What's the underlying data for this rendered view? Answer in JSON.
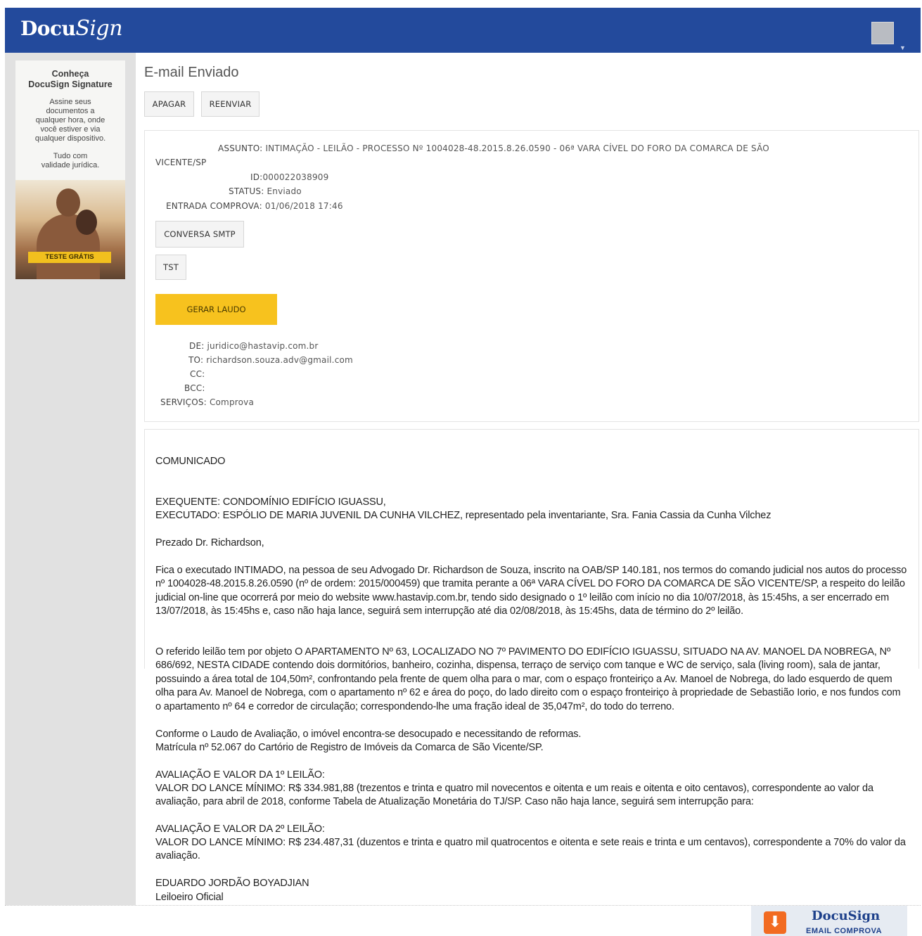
{
  "header": {
    "logo_docu": "Docu",
    "logo_sign": "Sign",
    "avatar_caret": "▼"
  },
  "promo": {
    "title_line1": "Conheça",
    "title_line2": "DocuSign Signature",
    "text_lines": [
      "Assine seus",
      "documentos a",
      "qualquer hora, onde",
      "você estiver e via",
      "qualquer dispositivo."
    ],
    "text2_lines": [
      "Tudo com",
      "validade jurídica."
    ],
    "cta": "TESTE GRÁTIS"
  },
  "page": {
    "title": "E-mail Enviado",
    "delete_label": "APAGAR",
    "resend_label": "REENVIAR"
  },
  "details": {
    "subject_label": "ASSUNTO:",
    "subject_value_line1": "INTIMAÇÃO - LEILÃO - PROCESSO Nº 1004028-48.2015.8.26.0590 - 06ª VARA CÍVEL DO FORO DA COMARCA DE SÃO",
    "subject_value_line2": "VICENTE/SP",
    "id_label": "ID:",
    "id_value": "000022038909",
    "status_label": "STATUS:",
    "status_value": "Enviado",
    "entry_label": "ENTRADA COMPROVA:",
    "entry_value": "01/06/2018 17:46",
    "smtp_button": "CONVERSA SMTP",
    "tst_button": "TST",
    "report_button": "GERAR LAUDO",
    "from_label": "DE:",
    "from_value": "juridico@hastavip.com.br",
    "to_label": "TO:",
    "to_value": "richardson.souza.adv@gmail.com",
    "cc_label": "CC:",
    "cc_value": "",
    "bcc_label": "BCC:",
    "bcc_value": "",
    "services_label": "SERVIÇOS:",
    "services_value": "Comprova"
  },
  "message": {
    "heading": "COMUNICADO",
    "exequente": "EXEQUENTE: CONDOMÍNIO EDIFÍCIO IGUASSU,",
    "executado": "EXECUTADO: ESPÓLIO DE MARIA JUVENIL DA CUNHA VILCHEZ, representado pela inventariante, Sra. Fania Cassia da Cunha Vilchez",
    "greeting": "Prezado Dr. Richardson,",
    "para1": "Fica o executado INTIMADO, na pessoa de seu Advogado Dr. Richardson de Souza, inscrito na OAB/SP 140.181, nos termos do comando judicial nos autos do processo nº 1004028-48.2015.8.26.0590 (nº de ordem: 2015/000459) que tramita perante a 06ª VARA CÍVEL DO FORO DA COMARCA DE SÃO VICENTE/SP, a respeito do leilão judicial on-line que ocorrerá por meio do website www.hastavip.com.br, tendo sido designado o 1º leilão com início no dia 10/07/2018, às 15:45hs, a ser encerrado em 13/07/2018, às 15:45hs e, caso não haja lance, seguirá sem interrupção até dia 02/08/2018, às 15:45hs, data de término do 2º leilão.",
    "para2": "O referido leilão tem por objeto O APARTAMENTO Nº 63, LOCALIZADO NO 7º PAVIMENTO DO EDIFÍCIO IGUASSU, SITUADO NA AV. MANOEL DA NOBREGA, Nº 686/692, NESTA CIDADE contendo dois dormitórios, banheiro, cozinha, dispensa, terraço de serviço com tanque e WC de serviço, sala (living room), sala de jantar, possuindo a área total de 104,50m², confrontando pela frente de quem olha para o mar, com o espaço fronteiriço a Av. Manoel de Nobrega, do lado esquerdo de quem olha para Av. Manoel de Nobrega, com o apartamento nº 62 e área do poço, do lado direito com o espaço fronteiriço à propriedade de Sebastião Iorio, e nos fundos com o apartamento nº 64 e corredor de circulação; correspondendo-lhe uma fração ideal de 35,047m², do todo do terreno.",
    "para2b": "Conforme o Laudo de Avaliação, o imóvel encontra-se desocupado e necessitando de reformas.",
    "para2c": "Matrícula nº 52.067 do Cartório de Registro de Imóveis da Comarca de São Vicente/SP.",
    "aval1_title": "AVALIAÇÃO E VALOR DA 1º LEILÃO:",
    "aval1_text": "VALOR DO LANCE MÍNIMO: R$ 334.981,88 (trezentos e trinta e quatro mil novecentos e oitenta e um reais e oitenta e oito centavos), correspondente ao valor da avaliação, para abril de 2018, conforme Tabela de Atualização Monetária do TJ/SP. Caso não haja lance, seguirá sem interrupção para:",
    "aval2_title": "AVALIAÇÃO E VALOR DA 2º LEILÃO:",
    "aval2_text": "VALOR DO LANCE MÍNIMO: R$ 234.487,31 (duzentos e trinta e quatro mil quatrocentos e oitenta e sete reais e trinta e um centavos), correspondente a 70% do valor da avaliação.",
    "signer": "EDUARDO JORDÃO BOYADJIAN",
    "signer_role": "Leiloeiro Oficial"
  },
  "badge": {
    "logo": "DocuSign",
    "sub": "EMAIL COMPROVA"
  }
}
